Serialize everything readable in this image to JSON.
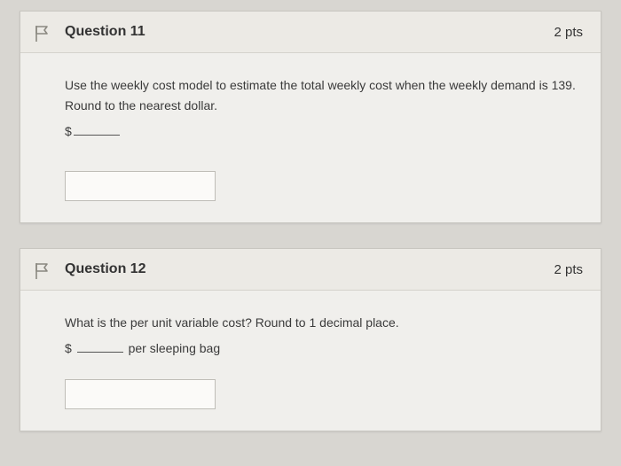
{
  "questions": [
    {
      "title": "Question 11",
      "points": "2 pts",
      "prompt_line1": "Use the weekly cost model to estimate the total weekly cost when the weekly demand is 139.",
      "prompt_line2": "Round to the nearest dollar.",
      "prefix": "$",
      "suffix": ""
    },
    {
      "title": "Question 12",
      "points": "2 pts",
      "prompt_line1": "What is the per unit variable cost?  Round to 1 decimal place.",
      "prefix": "$",
      "suffix": "per sleeping bag"
    }
  ]
}
